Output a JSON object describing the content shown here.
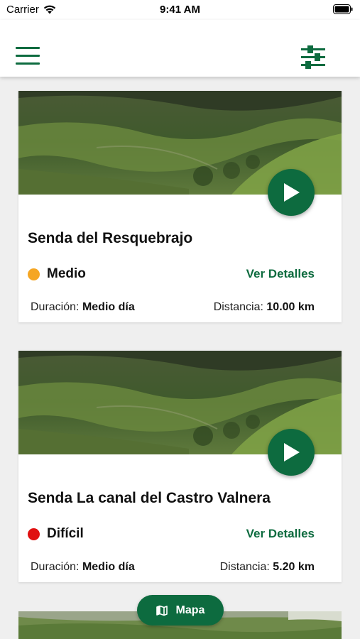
{
  "status_bar": {
    "carrier": "Carrier",
    "time": "9:41 AM"
  },
  "header": {
    "menu_icon": "hamburger-menu-icon",
    "filter_icon": "sliders-filter-icon"
  },
  "colors": {
    "brand_green": "#0d6b3f",
    "medium": "#f5a623",
    "difficult": "#e01010"
  },
  "routes": [
    {
      "title": "Senda del Resquebrajo",
      "level": "Medio",
      "level_color": "#f5a623",
      "details_label": "Ver Detalles",
      "duration_label": "Duración:",
      "duration_value": "Medio día",
      "distance_label": "Distancia:",
      "distance_value": "10.00 km"
    },
    {
      "title": "Senda La canal del Castro Valnera",
      "level": "Difícil",
      "level_color": "#e01010",
      "details_label": "Ver Detalles",
      "duration_label": "Duración:",
      "duration_value": "Medio día",
      "distance_label": "Distancia:",
      "distance_value": "5.20 km"
    }
  ],
  "map_button": {
    "label": "Mapa",
    "icon": "map-icon"
  }
}
